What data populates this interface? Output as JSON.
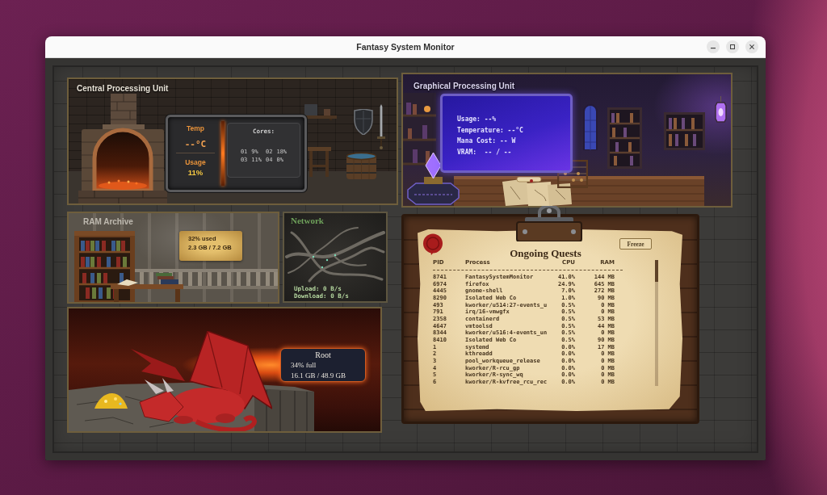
{
  "window": {
    "title": "Fantasy System Monitor"
  },
  "cpu": {
    "title": "Central Processing Unit",
    "temp_label": "Temp",
    "temp_value": "--°C",
    "usage_label": "Usage",
    "usage_value": "11%",
    "cores_label": "Cores:",
    "cores": [
      {
        "id": "01",
        "usage": "9%"
      },
      {
        "id": "02",
        "usage": "18%"
      },
      {
        "id": "03",
        "usage": "11%"
      },
      {
        "id": "04",
        "usage": "0%"
      }
    ]
  },
  "gpu": {
    "title": "Graphical Processing Unit",
    "lines": [
      "Usage: --%",
      "Temperature: --°C",
      "Mana Cost: -- W",
      "VRAM:  -- / --"
    ]
  },
  "ram": {
    "title": "RAM Archive",
    "used": "32% used",
    "amount": "2.3 GB / 7.2 GB"
  },
  "network": {
    "title": "Network",
    "upload": "Upload: 0 B/s",
    "download": "Download: 0 B/s"
  },
  "disk": {
    "name": "Root",
    "used": "34% full",
    "amount": "16.1 GB / 48.9 GB"
  },
  "quests": {
    "title": "Ongoing Quests",
    "freeze_button": "Freeze",
    "columns": [
      "PID",
      "Process",
      "CPU",
      "RAM"
    ],
    "rows": [
      {
        "pid": "8741",
        "process": "FantasySystemMonitor",
        "cpu": "41.0%",
        "ram": "144 MB"
      },
      {
        "pid": "6974",
        "process": "firefox",
        "cpu": "24.9%",
        "ram": "645 MB"
      },
      {
        "pid": "4445",
        "process": "gnome-shell",
        "cpu": "7.0%",
        "ram": "272 MB"
      },
      {
        "pid": "8290",
        "process": "Isolated Web Co",
        "cpu": "1.0%",
        "ram": "90 MB"
      },
      {
        "pid": "493",
        "process": "kworker/u514:27-events_u",
        "cpu": "0.5%",
        "ram": "0 MB"
      },
      {
        "pid": "791",
        "process": "irq/16-vmwgfx",
        "cpu": "0.5%",
        "ram": "0 MB"
      },
      {
        "pid": "2358",
        "process": "containerd",
        "cpu": "0.5%",
        "ram": "53 MB"
      },
      {
        "pid": "4647",
        "process": "vmtoolsd",
        "cpu": "0.5%",
        "ram": "44 MB"
      },
      {
        "pid": "8344",
        "process": "kworker/u516:4-events_un",
        "cpu": "0.5%",
        "ram": "0 MB"
      },
      {
        "pid": "8410",
        "process": "Isolated Web Co",
        "cpu": "0.5%",
        "ram": "90 MB"
      },
      {
        "pid": "1",
        "process": "systemd",
        "cpu": "0.0%",
        "ram": "17 MB"
      },
      {
        "pid": "2",
        "process": "kthreadd",
        "cpu": "0.0%",
        "ram": "0 MB"
      },
      {
        "pid": "3",
        "process": "pool_workqueue_release",
        "cpu": "0.0%",
        "ram": "0 MB"
      },
      {
        "pid": "4",
        "process": "kworker/R-rcu_gp",
        "cpu": "0.0%",
        "ram": "0 MB"
      },
      {
        "pid": "5",
        "process": "kworker/R-sync_wq",
        "cpu": "0.0%",
        "ram": "0 MB"
      },
      {
        "pid": "6",
        "process": "kworker/R-kvfree_rcu_rec",
        "cpu": "0.0%",
        "ram": "0 MB"
      }
    ]
  }
}
